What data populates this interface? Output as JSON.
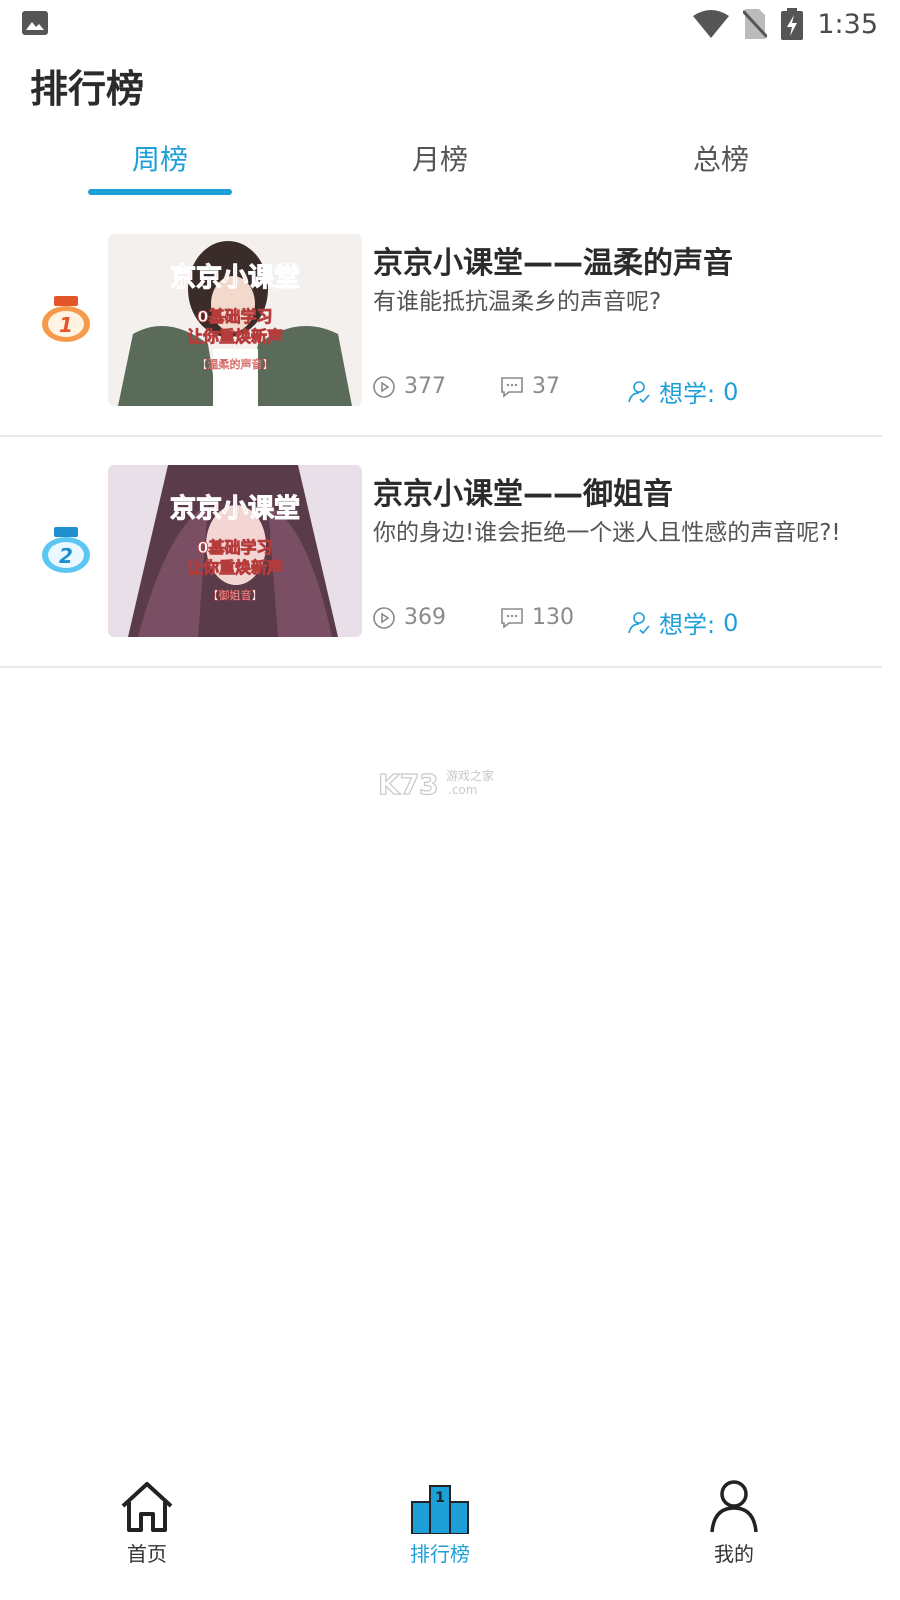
{
  "status_bar": {
    "time": "1:35",
    "icons": [
      "gallery-icon",
      "wifi-icon",
      "no-sim-icon",
      "battery-charging-icon"
    ]
  },
  "page": {
    "title": "排行榜"
  },
  "tabs": [
    {
      "label": "周榜",
      "active": true
    },
    {
      "label": "月榜",
      "active": false
    },
    {
      "label": "总榜",
      "active": false
    }
  ],
  "rankings": [
    {
      "rank": "1",
      "title": "京京小课堂——温柔的声音",
      "description": "有谁能抵抗温柔乡的声音呢?",
      "plays": "377",
      "comments": "37",
      "want_label": "想学:",
      "want_count": "0",
      "thumbnail": {
        "line1": "京京小课堂",
        "line2": "0基础学习",
        "line3": "让你重焕新声",
        "tag": "【温柔的声音】"
      }
    },
    {
      "rank": "2",
      "title": "京京小课堂——御姐音",
      "description": "你的身边!谁会拒绝一个迷人且性感的声音呢?!",
      "plays": "369",
      "comments": "130",
      "want_label": "想学:",
      "want_count": "0",
      "thumbnail": {
        "line1": "京京小课堂",
        "line2": "0基础学习",
        "line3": "让你重焕新声",
        "tag": "【御姐音】"
      }
    }
  ],
  "watermark": {
    "brand": "K73",
    "cn": "游戏之家",
    "domain": ".com"
  },
  "bottom_nav": [
    {
      "label": "首页",
      "icon": "home-icon",
      "active": false
    },
    {
      "label": "排行榜",
      "icon": "podium-icon",
      "active": true
    },
    {
      "label": "我的",
      "icon": "person-icon",
      "active": false
    }
  ],
  "colors": {
    "accent": "#1f9fd8",
    "medal_gold": "#f07b33",
    "medal_blue": "#3bb4ea"
  }
}
